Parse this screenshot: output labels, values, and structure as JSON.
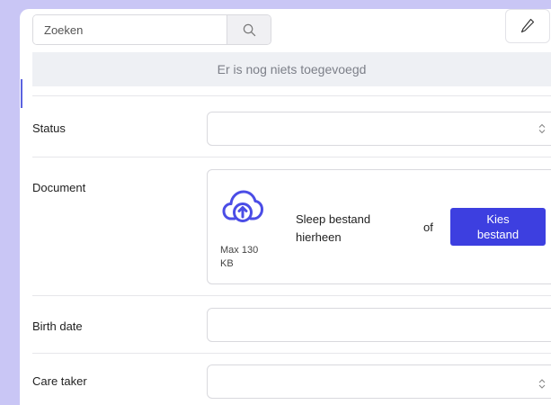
{
  "search": {
    "placeholder": "Zoeken"
  },
  "list": {
    "empty_message": "Er is nog niets toegevoegd"
  },
  "form": {
    "status": {
      "label": "Status",
      "value": ""
    },
    "document": {
      "label": "Document",
      "max_size": "Max 130 KB",
      "drop_text": "Sleep bestand hierheen",
      "or_text": "of",
      "choose_button": "Kies bestand"
    },
    "birth_date": {
      "label": "Birth date",
      "value": ""
    },
    "care_taker": {
      "label": "Care taker",
      "value": ""
    }
  },
  "colors": {
    "accent": "#3d3fe0",
    "upload_icon": "#4b4de6",
    "page_background": "#c9c6f5"
  },
  "icons": {
    "search": "search-icon",
    "edit": "pencil-icon",
    "select": "chevron-up-down-icon",
    "upload": "cloud-upload-icon"
  }
}
